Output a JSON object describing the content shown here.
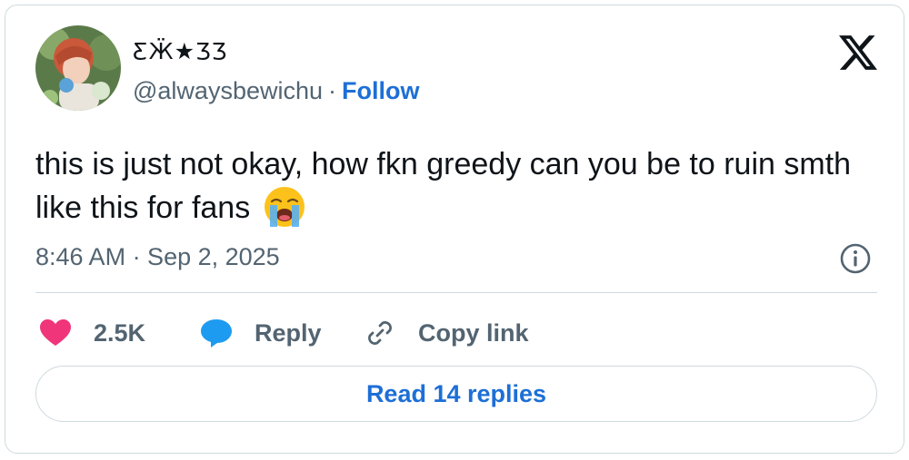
{
  "user": {
    "display_name": "ƸӜ★ƷƷ",
    "handle": "@alwaysbewichu",
    "separator": "·",
    "follow_label": "Follow"
  },
  "tweet": {
    "text": "this is just not okay, how fkn greedy can you be to ruin smth like this for fans",
    "emoji": "loudly-crying-face",
    "timestamp": "8:46 AM · Sep 2, 2025"
  },
  "actions": {
    "likes_count": "2.5K",
    "reply_label": "Reply",
    "copy_label": "Copy link"
  },
  "footer": {
    "read_replies_label": "Read 14 replies"
  },
  "colors": {
    "link_blue": "#1d6fd6",
    "like_pink": "#f0357a",
    "reply_blue": "#1d9bf0",
    "secondary_text": "#536471",
    "border": "#cfd9de"
  },
  "icons": [
    "x-logo-icon",
    "info-icon",
    "heart-icon",
    "speech-bubble-icon",
    "link-icon"
  ]
}
